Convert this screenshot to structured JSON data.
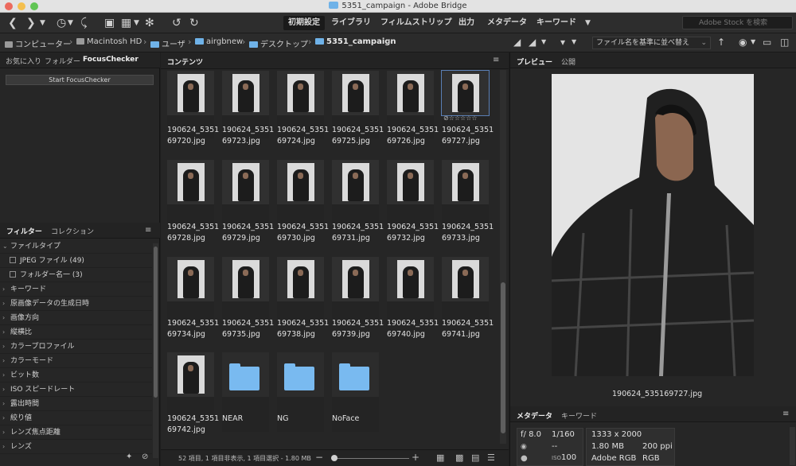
{
  "window": {
    "title": "5351_campaign - Adobe Bridge"
  },
  "toolbar": {
    "workspaces": [
      "初期設定",
      "ライブラリ",
      "フィルムストリップ",
      "出力",
      "メタデータ",
      "キーワード"
    ],
    "active_workspace": "初期設定",
    "search_placeholder": "Adobe Stock を検索"
  },
  "path": {
    "crumbs": [
      "コンピューター",
      "Macintosh HD",
      "ユーザ",
      "airgbnew",
      "デスクトップ",
      "5351_campaign"
    ],
    "sort_label": "ファイル名を基準に並べ替え"
  },
  "left": {
    "top_tabs": [
      "お気に入り",
      "フォルダー",
      "FocusChecker"
    ],
    "start_button": "Start FocusChecker",
    "bottom_tabs": [
      "フィルター",
      "コレクション"
    ],
    "filters": [
      {
        "label": "ファイルタイプ",
        "open": true
      },
      {
        "label": "JPEG ファイル (49)",
        "check": true
      },
      {
        "label": "フォルダー名一 (3)",
        "check": true
      },
      {
        "label": "キーワード"
      },
      {
        "label": "原画像データの生成日時"
      },
      {
        "label": "画像方向"
      },
      {
        "label": "縦横比"
      },
      {
        "label": "カラープロファイル"
      },
      {
        "label": "カラーモード"
      },
      {
        "label": "ビット数"
      },
      {
        "label": "ISO スピードレート"
      },
      {
        "label": "露出時間"
      },
      {
        "label": "絞り値"
      },
      {
        "label": "レンズ焦点距離"
      },
      {
        "label": "レンズ"
      }
    ]
  },
  "content": {
    "tab": "コンテンツ",
    "items": [
      [
        "190624_5351",
        "69720.jpg"
      ],
      [
        "190624_5351",
        "69723.jpg"
      ],
      [
        "190624_5351",
        "69724.jpg"
      ],
      [
        "190624_5351",
        "69725.jpg"
      ],
      [
        "190624_5351",
        "69726.jpg"
      ],
      [
        "190624_5351",
        "69727.jpg"
      ],
      [
        "190624_5351",
        "69728.jpg"
      ],
      [
        "190624_5351",
        "69729.jpg"
      ],
      [
        "190624_5351",
        "69730.jpg"
      ],
      [
        "190624_5351",
        "69731.jpg"
      ],
      [
        "190624_5351",
        "69732.jpg"
      ],
      [
        "190624_5351",
        "69733.jpg"
      ],
      [
        "190624_5351",
        "69734.jpg"
      ],
      [
        "190624_5351",
        "69735.jpg"
      ],
      [
        "190624_5351",
        "69738.jpg"
      ],
      [
        "190624_5351",
        "69739.jpg"
      ],
      [
        "190624_5351",
        "69740.jpg"
      ],
      [
        "190624_5351",
        "69741.jpg"
      ],
      [
        "190624_5351",
        "69742.jpg"
      ]
    ],
    "folders": [
      "NEAR",
      "NG",
      "NoFace"
    ],
    "rating_stars": "☆☆☆☆☆",
    "status": "52 項目, 1 項目非表示, 1 項目選択 - 1.80 MB"
  },
  "preview": {
    "tabs": [
      "プレビュー",
      "公開"
    ],
    "filename": "190624_535169727.jpg"
  },
  "metadata": {
    "tabs": [
      "メタデータ",
      "キーワード"
    ],
    "aperture": "f/ 8.0",
    "shutter": "1/160",
    "dash": "--",
    "iso_label": "ISO",
    "iso": "100",
    "dimensions": "1333 x 2000",
    "size": "1.80 MB",
    "ppi": "200 ppi",
    "profile": "Adobe RGB",
    "mode": "RGB"
  }
}
